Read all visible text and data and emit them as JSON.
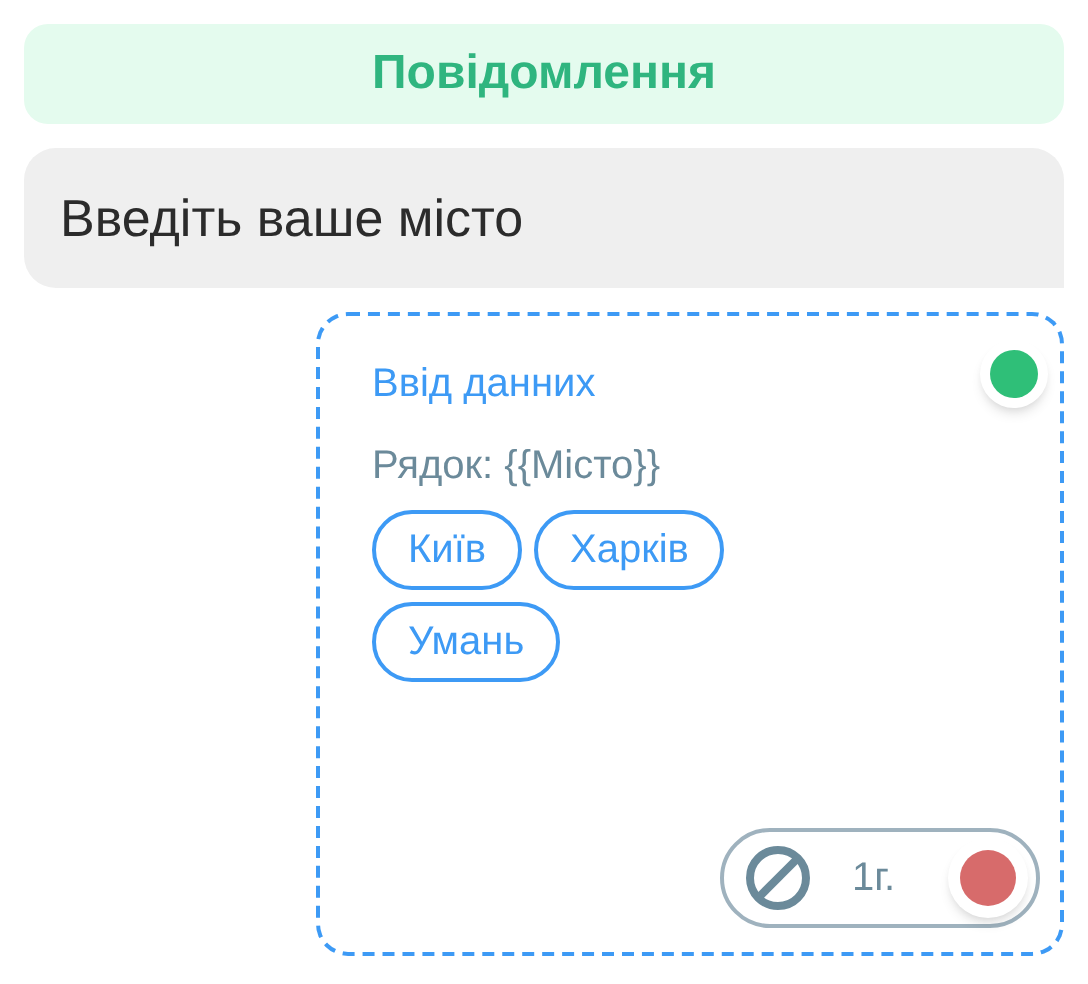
{
  "header": {
    "title": "Повідомлення"
  },
  "message": {
    "text": "Введіть ваше місто"
  },
  "input_card": {
    "title": "Ввід данних",
    "variable": "Рядок: {{Місто}}",
    "options": [
      {
        "label": "Київ"
      },
      {
        "label": "Харків"
      },
      {
        "label": "Умань"
      }
    ],
    "timeout": {
      "label": "1г."
    }
  }
}
